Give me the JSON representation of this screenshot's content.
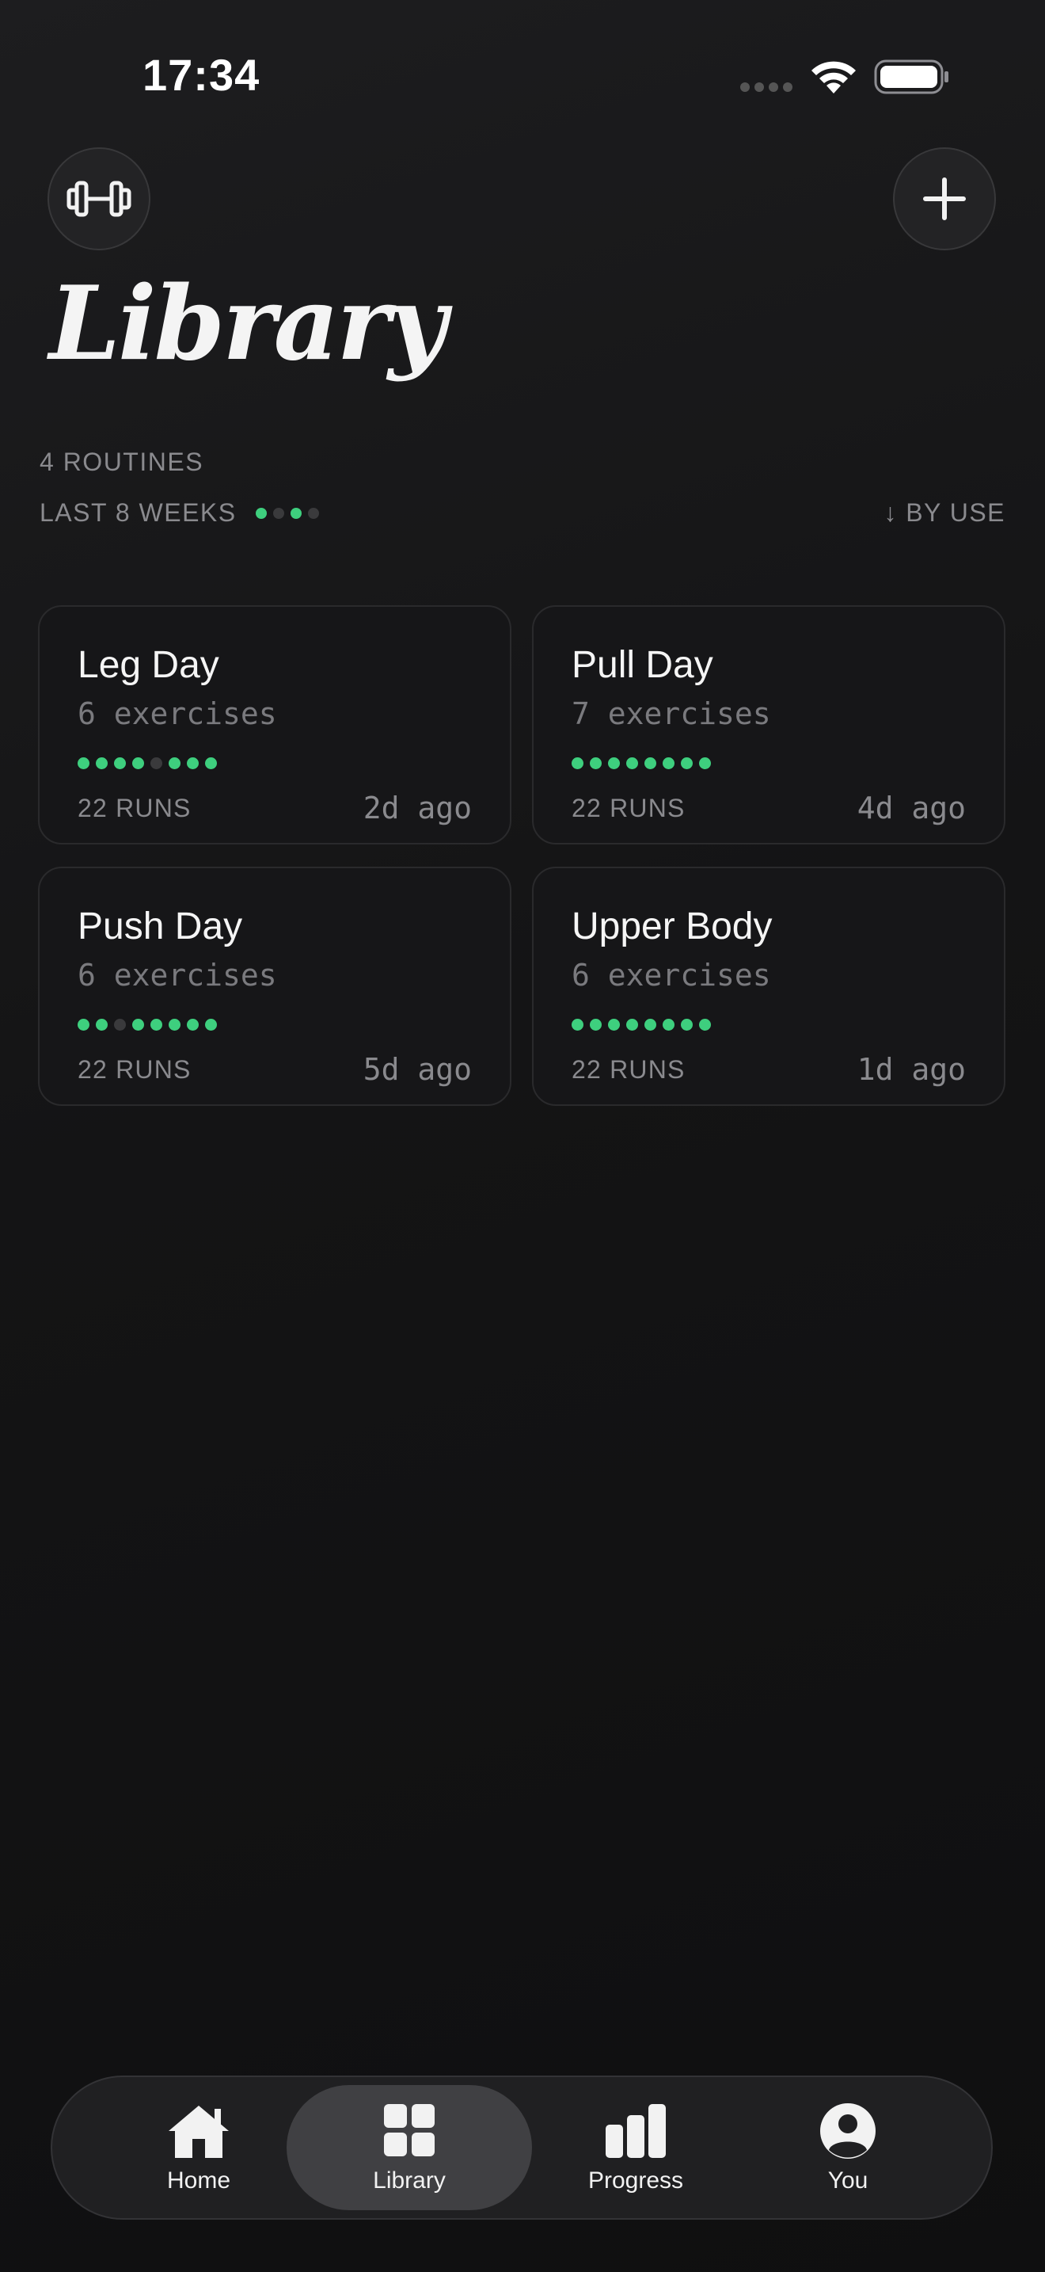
{
  "status_bar": {
    "time": "17:34"
  },
  "header": {
    "title": "Library",
    "left_icon": "dumbbell-icon",
    "right_icon": "plus-icon"
  },
  "meta": {
    "routine_count": "4 ROUTINES",
    "period": "LAST 8 WEEKS",
    "trend": [
      true,
      false,
      true,
      false
    ],
    "sort": "↓ BY USE"
  },
  "routines": [
    {
      "name": "Leg Day",
      "exercises": "6 exercises",
      "history": [
        true,
        true,
        true,
        true,
        false,
        true,
        true,
        true
      ],
      "runs": "22 RUNS",
      "last": "2d ago"
    },
    {
      "name": "Pull Day",
      "exercises": "7 exercises",
      "history": [
        true,
        true,
        true,
        true,
        true,
        true,
        true,
        true
      ],
      "runs": "22 RUNS",
      "last": "4d ago"
    },
    {
      "name": "Push Day",
      "exercises": "6 exercises",
      "history": [
        true,
        true,
        false,
        true,
        true,
        true,
        true,
        true
      ],
      "runs": "22 RUNS",
      "last": "5d ago"
    },
    {
      "name": "Upper Body",
      "exercises": "6 exercises",
      "history": [
        true,
        true,
        true,
        true,
        true,
        true,
        true,
        true
      ],
      "runs": "22 RUNS",
      "last": "1d ago"
    }
  ],
  "tabs": [
    {
      "label": "Home",
      "icon": "house-icon",
      "active": false
    },
    {
      "label": "Library",
      "icon": "grid-icon",
      "active": true
    },
    {
      "label": "Progress",
      "icon": "bar-chart-icon",
      "active": false
    },
    {
      "label": "You",
      "icon": "person-icon",
      "active": false
    }
  ],
  "colors": {
    "accent_green": "#3ecf7e",
    "inactive_dot": "#3a3a3c",
    "background": "#141415"
  }
}
